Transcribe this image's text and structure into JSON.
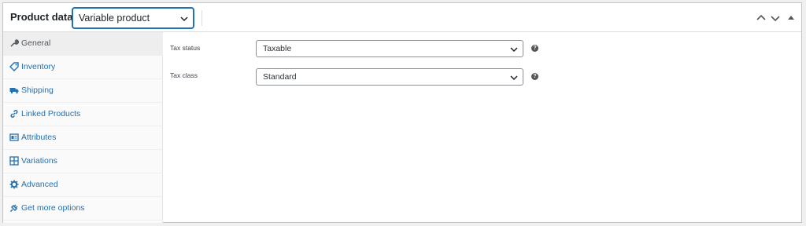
{
  "header": {
    "title": "Product data —",
    "product_type": "Variable product"
  },
  "tabs": [
    {
      "label": "General",
      "icon": "wrench-icon",
      "active": true
    },
    {
      "label": "Inventory",
      "icon": "tag-icon"
    },
    {
      "label": "Shipping",
      "icon": "truck-icon"
    },
    {
      "label": "Linked Products",
      "icon": "link-icon"
    },
    {
      "label": "Attributes",
      "icon": "list-icon"
    },
    {
      "label": "Variations",
      "icon": "grid-icon"
    },
    {
      "label": "Advanced",
      "icon": "gear-icon"
    },
    {
      "label": "Get more options",
      "icon": "plugin-icon"
    }
  ],
  "fields": {
    "tax_status": {
      "label": "Tax status",
      "value": "Taxable"
    },
    "tax_class": {
      "label": "Tax class",
      "value": "Standard"
    }
  },
  "colors": {
    "link": "#2271b1",
    "focus_border": "#2271b1"
  }
}
